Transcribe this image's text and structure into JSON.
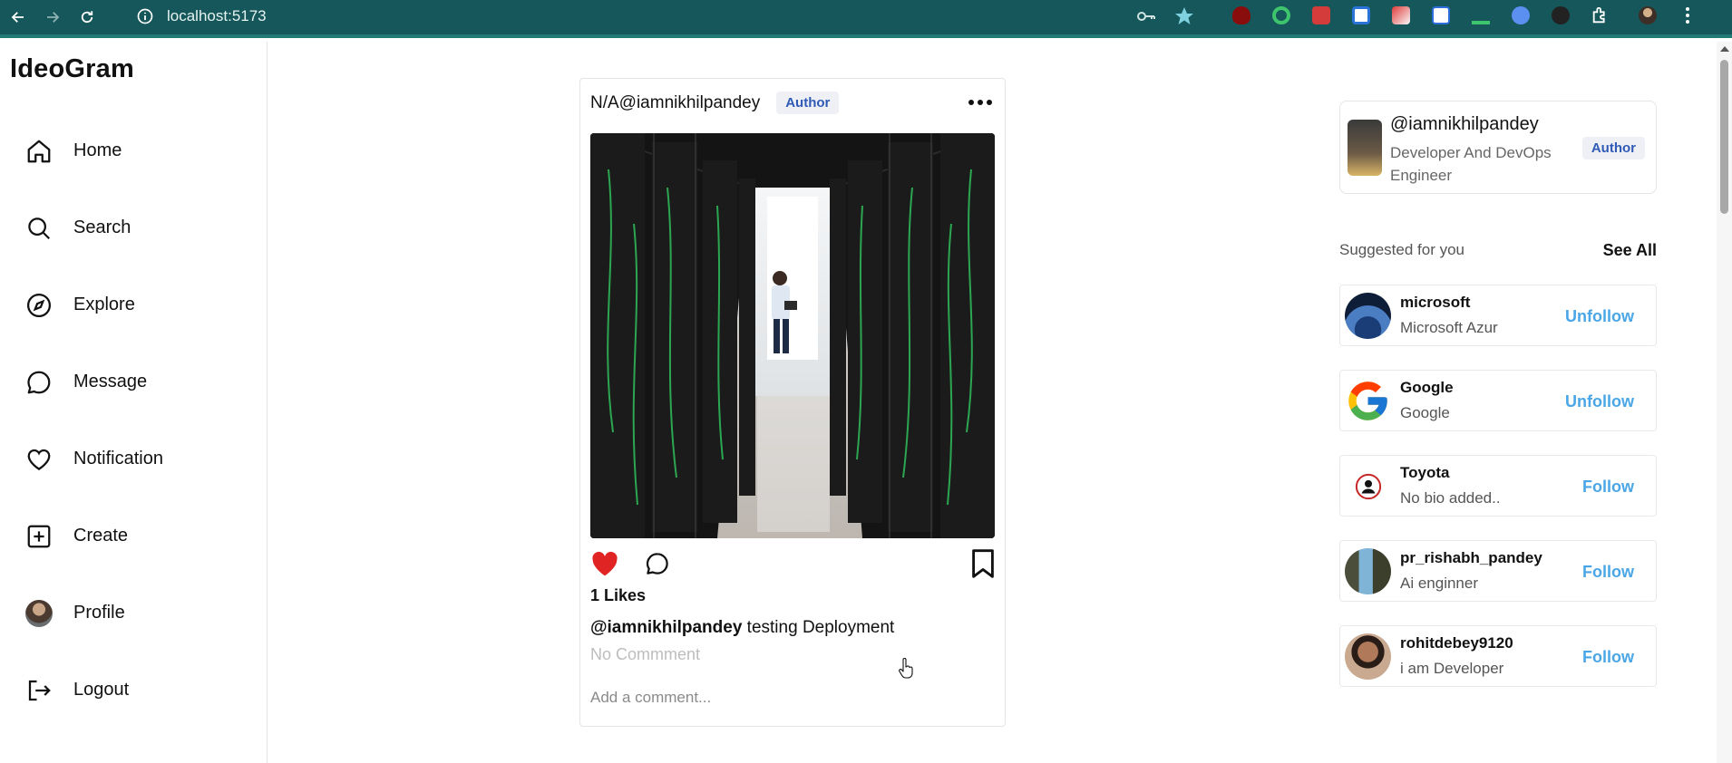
{
  "browser": {
    "url": "localhost:5173",
    "extensions": [
      "uBlock Origin",
      "green ring",
      "red bag",
      "screen share",
      "red palette",
      "image",
      "green mark",
      "blue shield",
      "dark triangle",
      "puzzle-icon"
    ],
    "accent": "#15575a"
  },
  "sidebar": {
    "brand": "IdeoGram",
    "items": [
      {
        "label": "Home",
        "icon": "home-icon"
      },
      {
        "label": "Search",
        "icon": "search-icon"
      },
      {
        "label": "Explore",
        "icon": "compass-icon"
      },
      {
        "label": "Message",
        "icon": "message-icon"
      },
      {
        "label": "Notification",
        "icon": "heart-icon"
      },
      {
        "label": "Create",
        "icon": "plus-square-icon"
      },
      {
        "label": "Profile",
        "icon": "avatar"
      },
      {
        "label": "Logout",
        "icon": "logout-icon"
      }
    ]
  },
  "post": {
    "user": "N/A@iamnikhilpandey",
    "badge": "Author",
    "likes": "1 Likes",
    "caption_user": "@iamnikhilpandey",
    "caption_text": " testing Deployment",
    "no_comment": "No Commment",
    "comment_placeholder": "Add a comment...",
    "liked": true,
    "like_color": "#e02424"
  },
  "profile_card": {
    "handle": "@iamnikhilpandey",
    "bio": "Developer And DevOps Engineer",
    "badge": "Author"
  },
  "suggestions": {
    "title": "Suggested for you",
    "see_all": "See All",
    "items": [
      {
        "name": "microsoft",
        "bio": "Microsoft Azur",
        "action": "Unfollow"
      },
      {
        "name": "Google",
        "bio": "Google",
        "action": "Unfollow"
      },
      {
        "name": "Toyota",
        "bio": "No bio added..",
        "action": "Follow"
      },
      {
        "name": "pr_rishabh_pandey",
        "bio": "Ai enginner",
        "action": "Follow"
      },
      {
        "name": "rohitdebey9120",
        "bio": "i am Developer",
        "action": "Follow"
      }
    ],
    "button_color": "#4aa6e6"
  }
}
